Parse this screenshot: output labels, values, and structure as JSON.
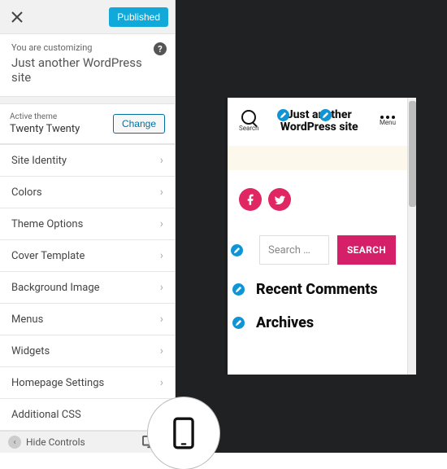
{
  "topbar": {
    "publish_label": "Published"
  },
  "intro": {
    "you_are": "You are customizing",
    "site_title": "Just another WordPress site"
  },
  "theme": {
    "active_label": "Active theme",
    "name": "Twenty Twenty",
    "change_label": "Change"
  },
  "sections": [
    "Site Identity",
    "Colors",
    "Theme Options",
    "Cover Template",
    "Background Image",
    "Menus",
    "Widgets",
    "Homepage Settings",
    "Additional CSS"
  ],
  "footer": {
    "hide_label": "Hide Controls"
  },
  "preview": {
    "search_label": "Search",
    "menu_label": "Menu",
    "title_line1": "Just another",
    "title_line2": "WordPress site",
    "search_placeholder": "Search …",
    "search_button": "SEARCH",
    "widget_recent": "Recent Comments",
    "widget_archives": "Archives"
  }
}
